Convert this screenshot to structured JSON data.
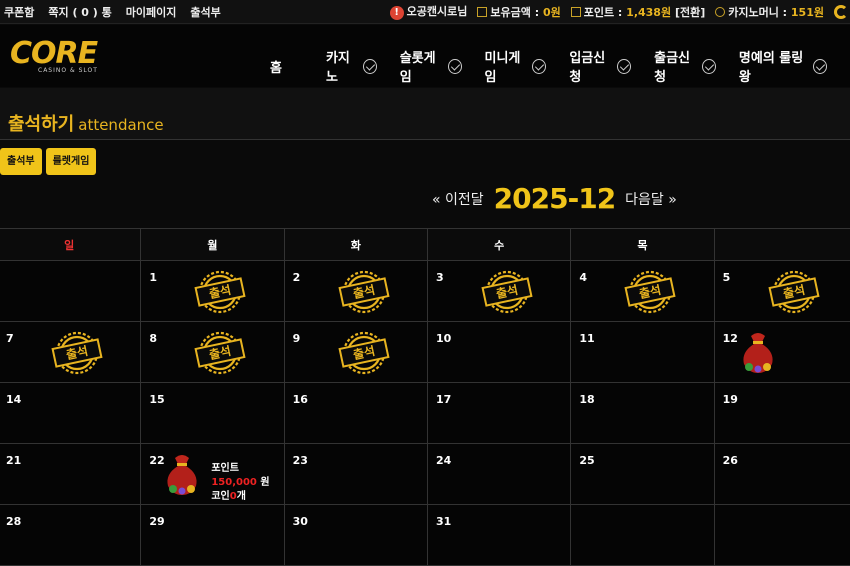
{
  "topbar": {
    "links": [
      "쿠폰함",
      "쪽지 ( 0 ) 통",
      "마이페이지",
      "출석부"
    ],
    "user": "오공캔시로님",
    "balance_label": "보유금액 :",
    "balance_value": "0원",
    "points_label": "포인트 :",
    "points_value": "1,438원",
    "points_convert": "[전환]",
    "casino_label": "카지노머니 :",
    "casino_value": "151원"
  },
  "logo": {
    "main": "CORE",
    "sub": "CASINO & SLOT"
  },
  "menu": [
    "홈",
    "카지노",
    "슬롯게임",
    "미니게임",
    "입금신청",
    "출금신청",
    "명예의 룰링왕"
  ],
  "page": {
    "title": "출석하기",
    "title_en": "attendance"
  },
  "tabs": [
    "출석부",
    "룰렛게임"
  ],
  "month_nav": {
    "prev": "« 이전달",
    "current": "2025-12",
    "next": "다음달 »"
  },
  "calendar": {
    "weekdays": [
      "일",
      "월",
      "화",
      "수",
      "목",
      ""
    ],
    "stamp_text": "출석",
    "weeks": [
      [
        {
          "day": ""
        },
        {
          "day": "1",
          "stamp": true
        },
        {
          "day": "2",
          "stamp": true
        },
        {
          "day": "3",
          "stamp": true
        },
        {
          "day": "4",
          "stamp": true
        },
        {
          "day": "5",
          "stamp": true
        }
      ],
      [
        {
          "day": "7",
          "stamp": true
        },
        {
          "day": "8",
          "stamp": true
        },
        {
          "day": "9",
          "stamp": true
        },
        {
          "day": "10"
        },
        {
          "day": "11"
        },
        {
          "day": "12",
          "bag": true
        }
      ],
      [
        {
          "day": "14"
        },
        {
          "day": "15"
        },
        {
          "day": "16"
        },
        {
          "day": "17"
        },
        {
          "day": "18"
        },
        {
          "day": "19"
        }
      ],
      [
        {
          "day": "21"
        },
        {
          "day": "22",
          "bag": true,
          "prize": {
            "line1": "포인트",
            "amount": "150,000",
            "unit": "원",
            "coin_label": "코인",
            "coin_value": "0",
            "coin_unit": "개"
          }
        },
        {
          "day": "23"
        },
        {
          "day": "24"
        },
        {
          "day": "25"
        },
        {
          "day": "26"
        }
      ],
      [
        {
          "day": "28"
        },
        {
          "day": "29"
        },
        {
          "day": "30"
        },
        {
          "day": "31"
        },
        {
          "day": ""
        },
        {
          "day": ""
        }
      ]
    ]
  },
  "colors": {
    "accent": "#e8b420",
    "sunday": "#e33333",
    "bg": "#0a0a0a"
  }
}
